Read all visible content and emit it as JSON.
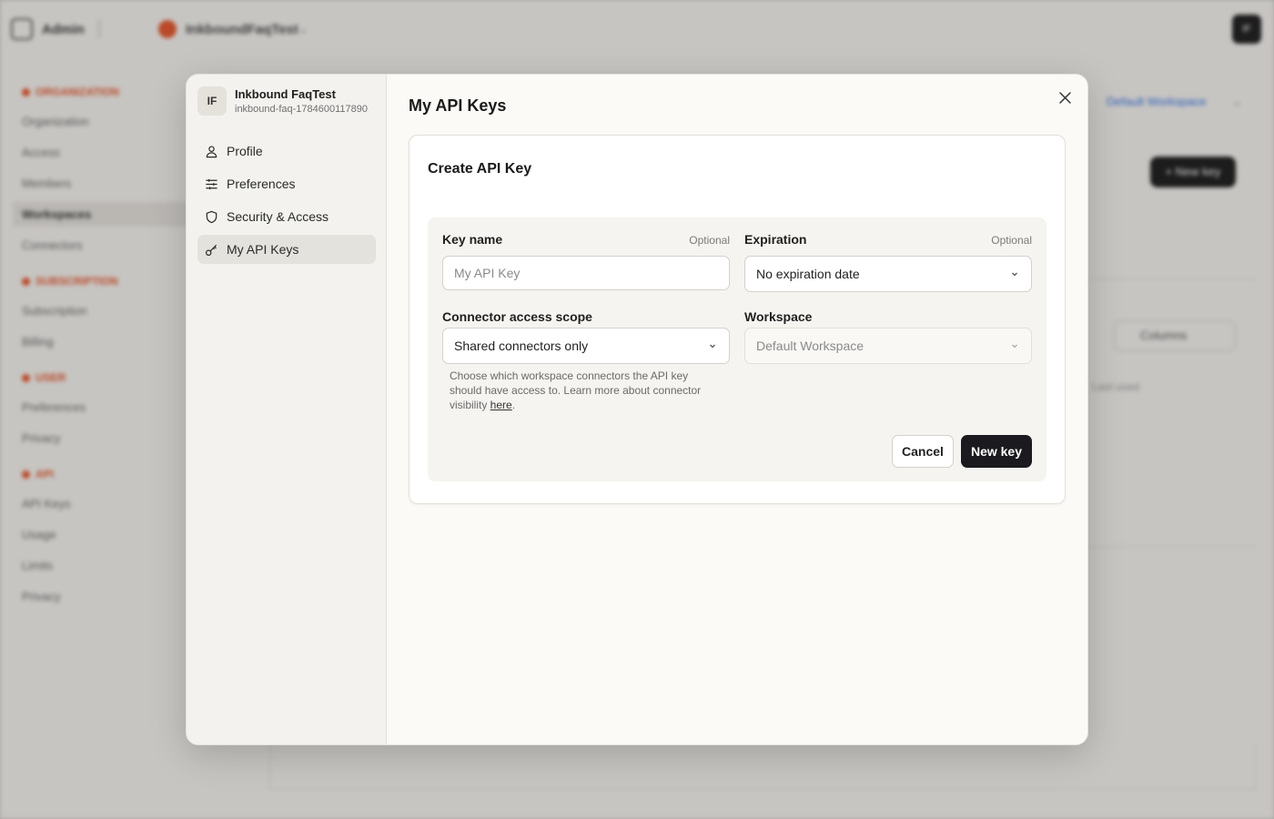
{
  "background": {
    "app_name": "Admin",
    "org_name": "InkboundFaqTest",
    "avatar_initial": "IF",
    "workspace_link": "Default Workspace",
    "new_key_button": "+ New key",
    "columns_button": "Columns",
    "last_used_header": "Last used",
    "sidebar": [
      {
        "type": "section",
        "label": "ORGANIZATION"
      },
      {
        "type": "item",
        "label": "Organization"
      },
      {
        "type": "item",
        "label": "Access"
      },
      {
        "type": "item",
        "label": "Members"
      },
      {
        "type": "item",
        "label": "Workspaces",
        "active": true
      },
      {
        "type": "item",
        "label": "Connectors"
      },
      {
        "type": "section",
        "label": "SUBSCRIPTION"
      },
      {
        "type": "item",
        "label": "Subscription"
      },
      {
        "type": "item",
        "label": "Billing"
      },
      {
        "type": "section",
        "label": "USER"
      },
      {
        "type": "item",
        "label": "Preferences"
      },
      {
        "type": "item",
        "label": "Privacy"
      },
      {
        "type": "section",
        "label": "API"
      },
      {
        "type": "item",
        "label": "API Keys"
      },
      {
        "type": "item",
        "label": "Usage"
      },
      {
        "type": "item",
        "label": "Limits"
      },
      {
        "type": "item",
        "label": "Privacy"
      }
    ]
  },
  "modal": {
    "user": {
      "initials": "IF",
      "name": "Inkbound FaqTest",
      "handle": "inkbound-faq-1784600117890"
    },
    "nav": [
      {
        "label": "Profile",
        "icon": "user-icon",
        "active": false
      },
      {
        "label": "Preferences",
        "icon": "sliders-icon",
        "active": false
      },
      {
        "label": "Security & Access",
        "icon": "shield-icon",
        "active": false
      },
      {
        "label": "My API Keys",
        "icon": "key-icon",
        "active": true
      }
    ],
    "title": "My API Keys",
    "card": {
      "title": "Create API Key",
      "key_name": {
        "label": "Key name",
        "optional": "Optional",
        "placeholder": "My API Key",
        "value": ""
      },
      "expiration": {
        "label": "Expiration",
        "optional": "Optional",
        "value": "No expiration date"
      },
      "scope": {
        "label": "Connector access scope",
        "value": "Shared connectors only"
      },
      "workspace": {
        "label": "Workspace",
        "value": "Default Workspace",
        "disabled": true
      },
      "help_text": "Choose which workspace connectors the API key should have access to. Learn more about connector visibility ",
      "help_link": "here",
      "help_end": ".",
      "cancel_label": "Cancel",
      "submit_label": "New key"
    }
  }
}
